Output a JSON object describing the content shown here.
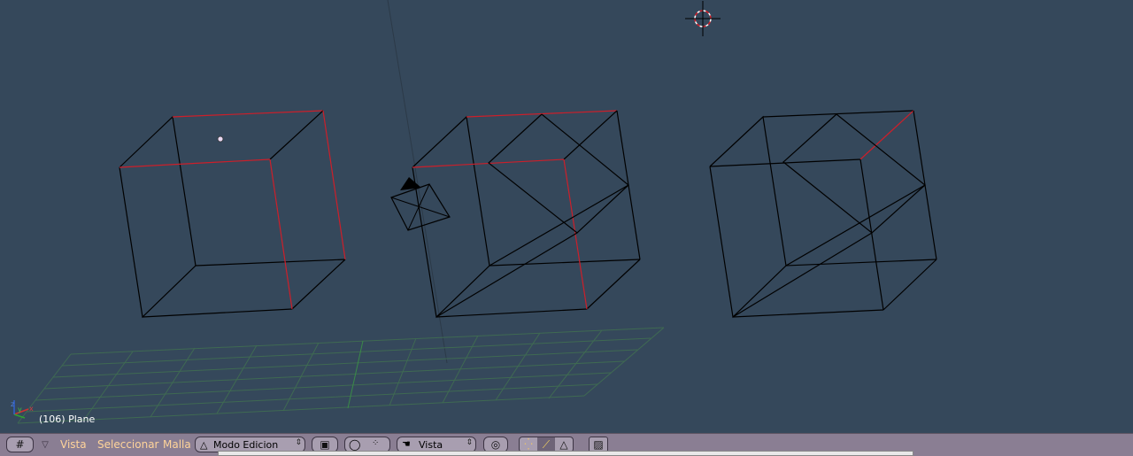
{
  "viewport": {
    "object_info": "(106) Plane",
    "axis_labels": {
      "x": "x",
      "y": "y",
      "z": "z"
    },
    "colors": {
      "background": "#35485b",
      "edge": "#000000",
      "selected_edge": "#cc1f2a",
      "grid": "#3f6a52"
    }
  },
  "header": {
    "view_type_icon": "grid-icon",
    "menus": [
      "Vista",
      "Seleccionar",
      "Malla"
    ],
    "mode": {
      "icon": "mode-triangle-icon",
      "label": "Modo Edicion"
    },
    "draw_type": {
      "label": "Vista"
    },
    "icons": [
      "object-select-icon",
      "pivot-icon",
      "dots-icon",
      "hand-icon",
      "proportional-icon",
      "vertex-select-icon",
      "edge-select-icon",
      "face-select-icon",
      "render-icon"
    ],
    "colors": {
      "bar": "#8a7e93",
      "menu_text": "#ffd49a"
    }
  }
}
